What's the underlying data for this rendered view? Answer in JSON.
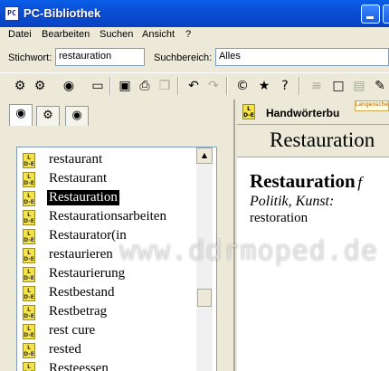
{
  "window": {
    "title": "PC-Bibliothek",
    "logo_text": "PC"
  },
  "menu": [
    "Datei",
    "Bearbeiten",
    "Suchen",
    "Ansicht",
    "?"
  ],
  "search": {
    "keyword_label": "Stichwort:",
    "keyword_value": "restauration",
    "area_label": "Suchbereich:",
    "area_value": "Alles"
  },
  "toolbar": {
    "icons": [
      "binoculars-icon",
      "binoculars-search-icon",
      "book-icon",
      "copy-window-icon",
      "save-icon",
      "print-icon",
      "copy-icon",
      "back-icon",
      "forward-icon",
      "copyright-icon",
      "bookmark-icon",
      "help-icon",
      "list-icon",
      "page-icon",
      "document-icon",
      "edit-icon"
    ]
  },
  "tabs": [
    "eye-icon",
    "binoculars-icon",
    "book-icon"
  ],
  "dict_icon_text": [
    "L",
    "D-E"
  ],
  "list": [
    {
      "word": "restaurant",
      "selected": false
    },
    {
      "word": "Restaurant",
      "selected": false
    },
    {
      "word": "Restauration",
      "selected": true
    },
    {
      "word": "Restaurationsarbeiten",
      "selected": false
    },
    {
      "word": "Restaurator(in",
      "selected": false
    },
    {
      "word": "restaurieren",
      "selected": false
    },
    {
      "word": "Restaurierung",
      "selected": false
    },
    {
      "word": "Restbestand",
      "selected": false
    },
    {
      "word": "Restbetrag",
      "selected": false
    },
    {
      "word": "rest cure",
      "selected": false
    },
    {
      "word": "rested",
      "selected": false
    },
    {
      "word": "Resteessen",
      "selected": false
    }
  ],
  "dictionary": {
    "name": "Handwörterbu",
    "publisher": "Langenscheidt",
    "headword": "Restauration"
  },
  "entry": {
    "headword": "Restauration",
    "gender": "f",
    "domain": "Politik, Kunst:",
    "translation": "restoration"
  },
  "watermark": "www.ddrmoped.de",
  "colors": {
    "titlebar": "#0b4fd5",
    "selection": "#000000",
    "dict_icon": "#f3e24a"
  }
}
